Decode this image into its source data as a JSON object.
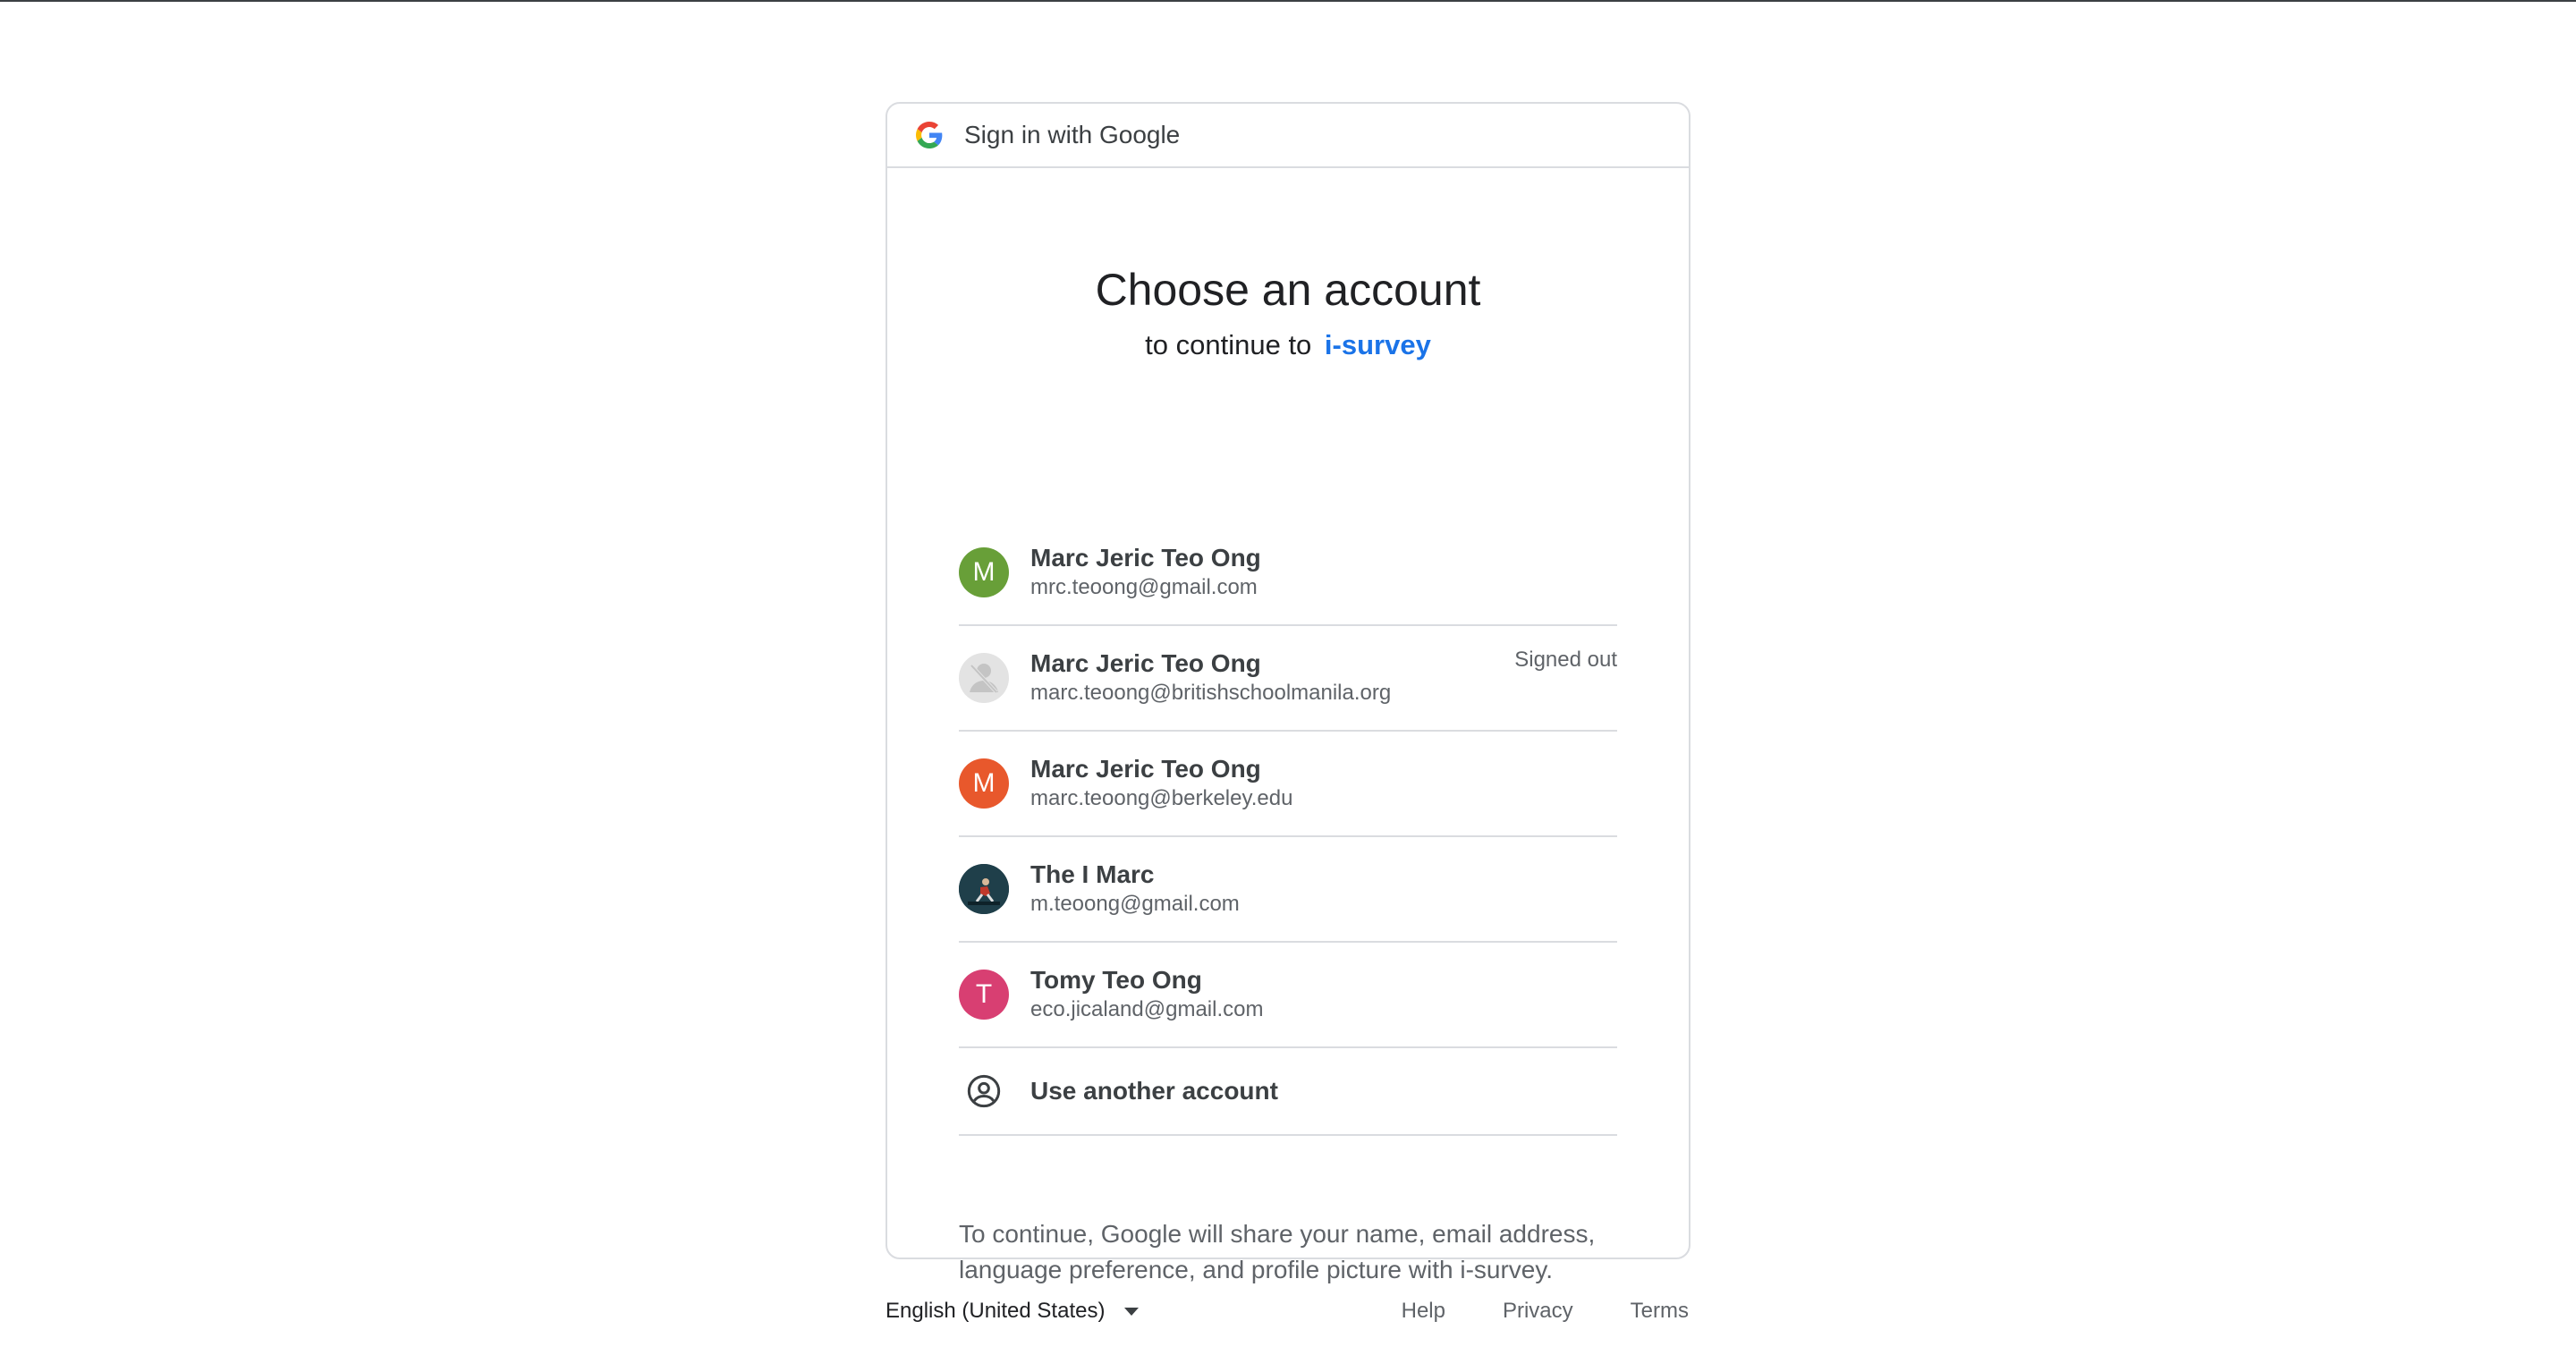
{
  "header": {
    "title": "Sign in with Google"
  },
  "main": {
    "title": "Choose an account",
    "subtitle_prefix": "to continue to",
    "app_name": "i-survey"
  },
  "accounts": [
    {
      "name": "Marc Jeric Teo Ong",
      "email": "mrc.teoong@gmail.com",
      "initial": "M",
      "color": "#689f38"
    },
    {
      "name": "Marc Jeric Teo Ong",
      "email": "marc.teoong@britishschoolmanila.org",
      "status": "Signed out",
      "color": "#dadce0"
    },
    {
      "name": "Marc Jeric Teo Ong",
      "email": "marc.teoong@berkeley.edu",
      "initial": "M",
      "color": "#e8582c"
    },
    {
      "name": "The I Marc",
      "email": "m.teoong@gmail.com",
      "icon": "photo-avatar",
      "color": "#1f3f4a"
    },
    {
      "name": "Tomy Teo Ong",
      "email": "eco.jicaland@gmail.com",
      "initial": "T",
      "color": "#d83f72"
    }
  ],
  "another_account": {
    "label": "Use another account",
    "icon": "account-circle-icon"
  },
  "consent": {
    "line1": "To continue, Google will share your name, email address,",
    "line2": "language preference, and profile picture with i-survey."
  },
  "footer": {
    "language": "English (United States)",
    "help": "Help",
    "privacy": "Privacy",
    "terms": "Terms"
  }
}
